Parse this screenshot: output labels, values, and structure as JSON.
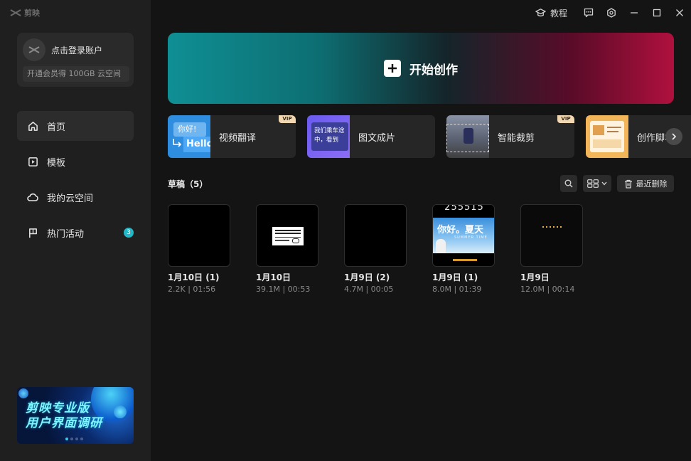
{
  "app": {
    "logo_text": "剪映"
  },
  "account": {
    "login_label": "点击登录账户",
    "vip_promo": "开通会员得 100GB 云空间"
  },
  "nav": {
    "items": [
      {
        "label": "首页",
        "icon": "home-icon",
        "active": true
      },
      {
        "label": "模板",
        "icon": "template-icon"
      },
      {
        "label": "我的云空间",
        "icon": "cloud-icon"
      },
      {
        "label": "热门活动",
        "icon": "flag-icon",
        "badge": "3"
      }
    ]
  },
  "banner": {
    "line1": "剪映专业版",
    "line2": "用户界面调研"
  },
  "titlebar": {
    "tutorial_label": "教程"
  },
  "hero": {
    "label": "开始创作"
  },
  "tools": [
    {
      "label": "视频翻译",
      "vip": "VIP",
      "thumb_top": "你好!",
      "thumb_bottom": "Hello"
    },
    {
      "label": "图文成片",
      "thumb_text": "我们乘车途中，看到"
    },
    {
      "label": "智能裁剪",
      "vip": "VIP"
    },
    {
      "label": "创作脚本"
    }
  ],
  "drafts": {
    "title": "草稿（5）",
    "recent_delete_label": "最近删除",
    "items": [
      {
        "title": "1月10日 (1)",
        "meta": "2.2K | 01:56",
        "thumb": "black"
      },
      {
        "title": "1月10日",
        "meta": "39.1M | 00:53",
        "thumb": "card"
      },
      {
        "title": "1月9日 (2)",
        "meta": "4.7M | 00:05",
        "thumb": "black"
      },
      {
        "title": "1月9日 (1)",
        "meta": "8.0M | 01:39",
        "thumb": "summer",
        "overlay_top": "255515",
        "overlay_main": "你好。夏天",
        "overlay_sub": "SUMMER TIME"
      },
      {
        "title": "1月9日",
        "meta": "12.0M | 00:14",
        "thumb": "dots"
      }
    ]
  },
  "colors": {
    "accent_teal": "#22b8c8",
    "hero_left": "#0f8f94",
    "hero_right": "#b0103e",
    "vip_gold": "#f1d8b2"
  }
}
